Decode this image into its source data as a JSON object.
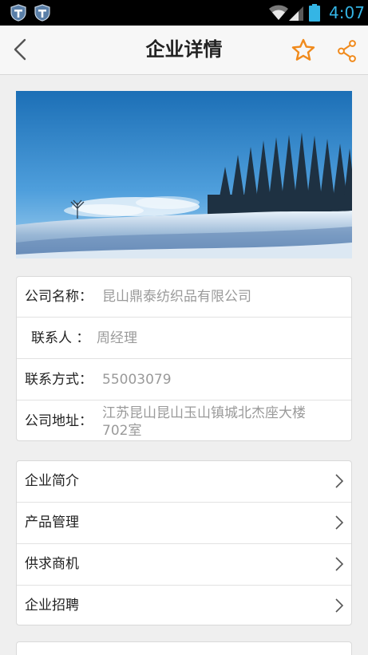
{
  "status_bar": {
    "time": "4:07",
    "icons": [
      "shield-app-icon",
      "shield-app-icon",
      "wifi-icon",
      "signal-icon",
      "battery-icon"
    ],
    "time_color": "#34b5e5"
  },
  "header": {
    "title": "企业详情",
    "accent_color": "#f08a1c",
    "icons": [
      "back-icon",
      "star-icon",
      "share-icon"
    ]
  },
  "company_info": {
    "name_label": "公司名称：",
    "name_value": "昆山鼎泰纺织品有限公司",
    "contact_label": "联系人 ：",
    "contact_value": "周经理",
    "phone_label": "联系方式：",
    "phone_value": "55003079",
    "address_label": "公司地址：",
    "address_value": "江苏昆山昆山玉山镇城北杰座大楼702室"
  },
  "menu": {
    "items": [
      {
        "label": "企业简介"
      },
      {
        "label": "产品管理"
      },
      {
        "label": "供求商机"
      },
      {
        "label": "企业招聘"
      }
    ],
    "chevron_icon": "chevron-right-icon"
  }
}
